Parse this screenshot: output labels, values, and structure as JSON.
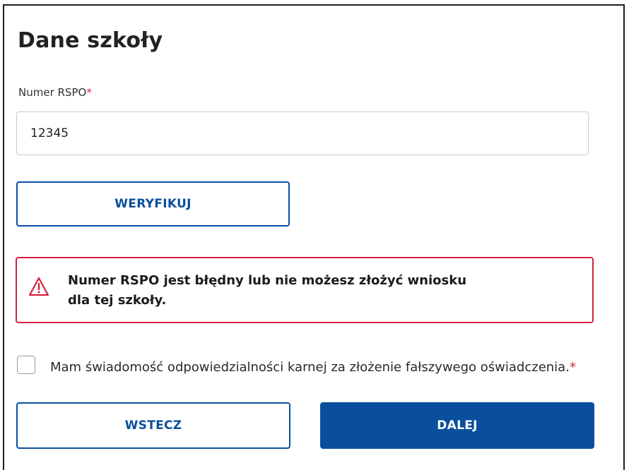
{
  "form": {
    "title": "Dane szkoły",
    "rspo_label": "Numer RSPO",
    "required_marker": "*",
    "rspo_value": "12345",
    "verify_label": "WERYFIKUJ"
  },
  "alert": {
    "icon": "warning-triangle-icon",
    "message_line1": "Numer RSPO jest błędny lub nie możesz złożyć wniosku",
    "message_line2": "dla tej szkoły."
  },
  "consent": {
    "checked": false,
    "label": "Mam świadomość odpowiedzialności karnej za złożenie fałszywego oświadczenia.",
    "required_marker": "*"
  },
  "nav": {
    "back_label": "WSTECZ",
    "next_label": "DALEJ"
  },
  "colors": {
    "primary": "#0a4f9e",
    "error": "#d4213d"
  }
}
